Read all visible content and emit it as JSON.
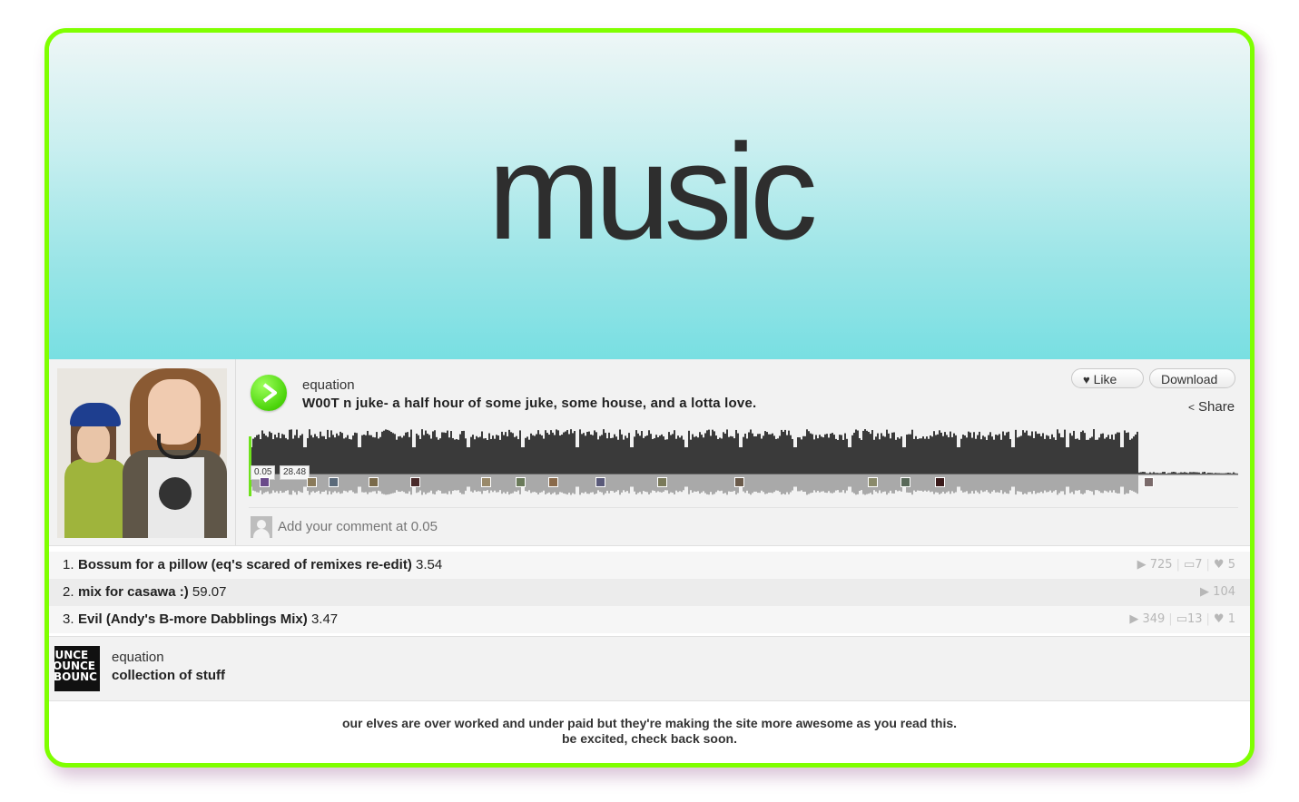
{
  "banner": {
    "title": "music"
  },
  "player": {
    "uploader": "equation",
    "title": "W00T n juke- a half hour of some juke, some house, and a lotta love.",
    "like_label": "Like",
    "download_label": "Download",
    "share_label": "Share",
    "current_time": "0.05",
    "total_time": "28.48",
    "comment_placeholder": "Add your comment at 0.05"
  },
  "tracks": [
    {
      "num": "1.",
      "title": "Bossum for a pillow (eq's scared of remixes re-edit)",
      "duration": "3.54",
      "plays": "725",
      "comments": "7",
      "likes": "5"
    },
    {
      "num": "2.",
      "title": "mix for casawa :)",
      "duration": "59.07",
      "plays": "104"
    },
    {
      "num": "3.",
      "title": "Evil (Andy's B-more Dabblings Mix)",
      "duration": "3.47",
      "plays": "349",
      "comments": "13",
      "likes": "1"
    }
  ],
  "playlist": {
    "user": "equation",
    "title": "collection of stuff",
    "art_text": [
      "JUNCE",
      "OUNCE",
      "BOUNC"
    ]
  },
  "footer": {
    "line1": "our elves are over worked and under paid but they're making the site more awesome as you read this.",
    "line2": "be excited, check back soon."
  },
  "colors": {
    "frame": "#7fff00",
    "play": "#4bd40a",
    "banner_bottom": "#78dfe2"
  }
}
